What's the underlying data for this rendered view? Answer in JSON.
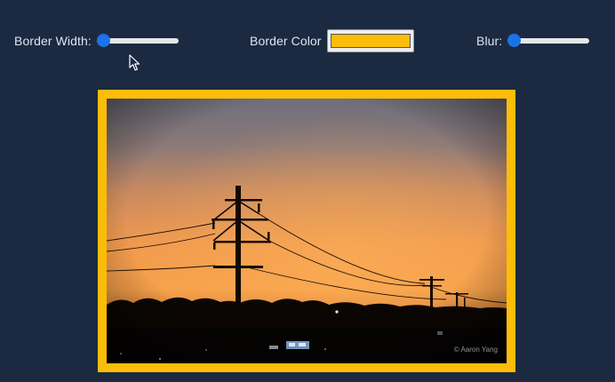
{
  "controls": {
    "border_width": {
      "label": "Border Width:",
      "value_fraction": 0.0
    },
    "border_color": {
      "label": "Border Color",
      "value": "#fbbd09"
    },
    "blur": {
      "label": "Blur:",
      "value_fraction": 0.0
    }
  },
  "image": {
    "watermark": "© Aaron Yang",
    "border_color": "#fbbd09"
  },
  "theme": {
    "background": "#1b2a41",
    "accent": "#1a73e8"
  }
}
